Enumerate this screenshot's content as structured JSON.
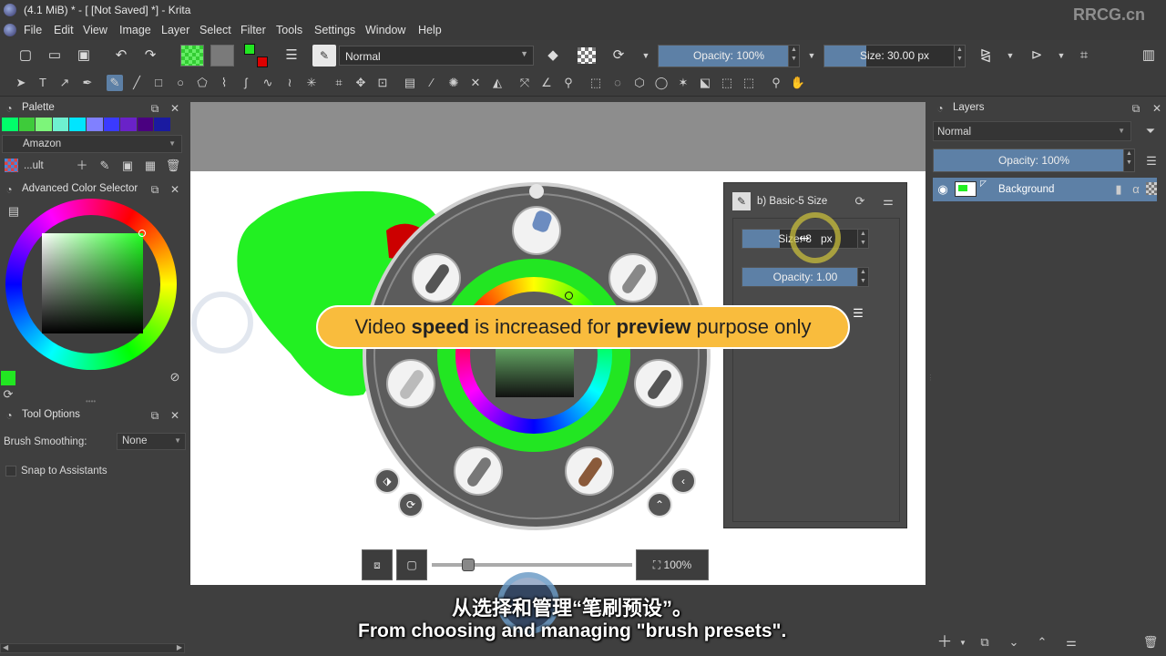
{
  "titlebar": {
    "title": "(4.1 MiB)  * - [ [Not Saved]  *] - Krita"
  },
  "menu": [
    "File",
    "Edit",
    "View",
    "Image",
    "Layer",
    "Select",
    "Filter",
    "Tools",
    "Settings",
    "Window",
    "Help"
  ],
  "toolbar": {
    "blend_mode": "Normal",
    "opacity": "Opacity: 100%",
    "opacity_value": 1.0,
    "size": "Size: 30.00 px",
    "size_fraction": 0.3
  },
  "palette": {
    "title": "Palette",
    "name": "Amazon",
    "resource": "...ult",
    "swatches": [
      "#00ff6a",
      "#3ecb3a",
      "#7df57a",
      "#6ef0d0",
      "#00e5ff",
      "#8080ff",
      "#3a3aff",
      "#6a22c8",
      "#4a0080",
      "#1a1aa0"
    ]
  },
  "color_selector": {
    "title": "Advanced Color Selector",
    "fg_color": "#22e622"
  },
  "tool_options": {
    "title": "Tool Options",
    "brush_smoothing_label": "Brush Smoothing:",
    "brush_smoothing_value": "None",
    "snap_label": "Snap to Assistants"
  },
  "popup": {
    "preset_name": "b) Basic-5 Size",
    "size_label": "Size: 3",
    "size_unit": "px",
    "opacity_label": "Opacity: 1.00"
  },
  "banner": {
    "part1": "Video ",
    "part2": "speed",
    "part3": " is increased for ",
    "part4": "preview",
    "part5": " purpose only"
  },
  "zoom": {
    "label": "100%",
    "slider_value": 0.18
  },
  "layers": {
    "title": "Layers",
    "blend_mode": "Normal",
    "opacity": "Opacity:  100%",
    "items": [
      {
        "name": "Background"
      }
    ]
  },
  "subtitles": {
    "zh": "从选择和管理“笔刷预设”。",
    "en": "From choosing and managing \"brush presets\"."
  },
  "watermark": {
    "corner": "RRCG.cn"
  },
  "colors": {
    "accent": "#5d80a6",
    "banner": "#f9bc3d",
    "green": "#22e622"
  }
}
